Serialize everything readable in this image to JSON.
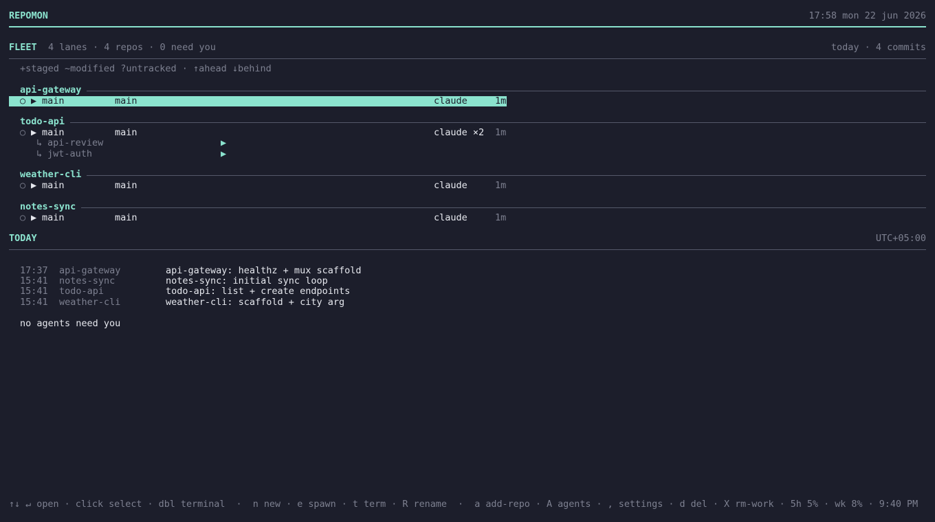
{
  "header": {
    "app_title": "REPOMON",
    "clock": "17:58 mon 22 jun 2026"
  },
  "fleet": {
    "title": "FLEET",
    "summary": "4 lanes · 4 repos · 0 need you",
    "right": "today · 4 commits",
    "legend": "+staged ~modified ?untracked · ↑ahead ↓behind",
    "lanes": [
      {
        "name": "api-gateway",
        "rows": [
          {
            "dot": "○",
            "arrow": "▶",
            "branch": "main",
            "base": "main",
            "agent": "claude",
            "age": "1m",
            "selected": true
          }
        ],
        "subs": []
      },
      {
        "name": "todo-api",
        "rows": [
          {
            "dot": "○",
            "arrow": "▶",
            "branch": "main",
            "base": "main",
            "agent": "claude ×2",
            "age": "1m",
            "selected": false
          }
        ],
        "subs": [
          {
            "prefix": "↳",
            "name": "api-review",
            "marker": "▶"
          },
          {
            "prefix": "↳",
            "name": "jwt-auth",
            "marker": "▶"
          }
        ]
      },
      {
        "name": "weather-cli",
        "rows": [
          {
            "dot": "○",
            "arrow": "▶",
            "branch": "main",
            "base": "main",
            "agent": "claude",
            "age": "1m",
            "selected": false
          }
        ],
        "subs": []
      },
      {
        "name": "notes-sync",
        "rows": [
          {
            "dot": "○",
            "arrow": "▶",
            "branch": "main",
            "base": "main",
            "agent": "claude",
            "age": "1m",
            "selected": false
          }
        ],
        "subs": []
      }
    ]
  },
  "today": {
    "title": "TODAY",
    "tz": "UTC+05:00",
    "commits": [
      {
        "time": "17:37",
        "repo": "api-gateway",
        "message": "api-gateway: healthz + mux scaffold"
      },
      {
        "time": "15:41",
        "repo": "notes-sync",
        "message": "notes-sync: initial sync loop"
      },
      {
        "time": "15:41",
        "repo": "todo-api",
        "message": "todo-api: list + create endpoints"
      },
      {
        "time": "15:41",
        "repo": "weather-cli",
        "message": "weather-cli: scaffold + city arg"
      }
    ],
    "status": "no agents need you"
  },
  "footer": {
    "keys": "↑↓ ↵ open · click select · dbl terminal  ·  n new · e spawn · t term · R rename  ·  a add-repo · A agents · , settings · d del · X rm-work · 5h 5% · wk 8% · 9:40 PM"
  },
  "colors": {
    "background": "#1c1e2b",
    "accent": "#8be3ce",
    "text": "#e6e8ee",
    "dim": "#7d8090"
  }
}
